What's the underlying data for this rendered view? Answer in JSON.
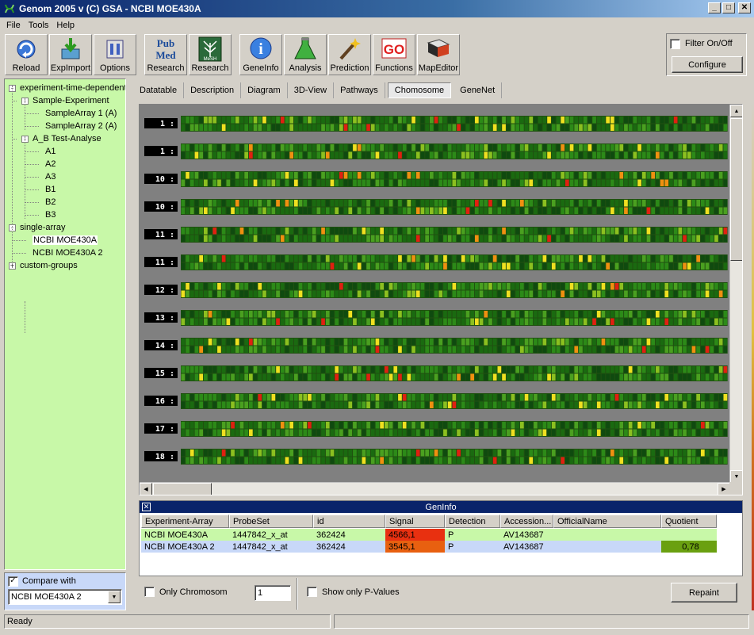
{
  "window": {
    "title": "Genom 2005 v (C) GSA - NCBI MOE430A"
  },
  "menu": [
    "File",
    "Tools",
    "Help"
  ],
  "toolbar": {
    "buttons": [
      {
        "label": "Reload",
        "icon": "reload-icon"
      },
      {
        "label": "ExpImport",
        "icon": "import-icon"
      },
      {
        "label": "Options",
        "icon": "options-icon"
      },
      {
        "label": "Research",
        "icon": "pubmed-icon",
        "badge": "Pub Med"
      },
      {
        "label": "Research",
        "icon": "mesh-icon",
        "badge": "MeSH"
      },
      {
        "label": "GeneInfo",
        "icon": "info-icon"
      },
      {
        "label": "Analysis",
        "icon": "flask-icon"
      },
      {
        "label": "Prediction",
        "icon": "wand-icon"
      },
      {
        "label": "Functions",
        "icon": "go-icon",
        "badge": "GO"
      },
      {
        "label": "MapEditor",
        "icon": "book-icon"
      }
    ],
    "filter_label": "Filter On/Off",
    "configure_label": "Configure"
  },
  "tree": {
    "nodes": [
      {
        "label": "experiment-time-dependent",
        "level": 0,
        "expander": "-"
      },
      {
        "label": "Sample-Experiment",
        "level": 1,
        "expander": "-"
      },
      {
        "label": "SampleArray 1 (A)",
        "level": 2
      },
      {
        "label": "SampleArray 2 (A)",
        "level": 2
      },
      {
        "label": "A_B Test-Analyse",
        "level": 1,
        "expander": "-"
      },
      {
        "label": "A1",
        "level": 2
      },
      {
        "label": "A2",
        "level": 2
      },
      {
        "label": "A3",
        "level": 2
      },
      {
        "label": "B1",
        "level": 2
      },
      {
        "label": "B2",
        "level": 2
      },
      {
        "label": "B3",
        "level": 2
      },
      {
        "label": "single-array",
        "level": 0,
        "expander": "-"
      },
      {
        "label": "NCBI MOE430A",
        "level": 1,
        "selected": true
      },
      {
        "label": "NCBI MOE430A 2",
        "level": 1
      },
      {
        "label": "custom-groups",
        "level": 0,
        "expander": "+"
      }
    ]
  },
  "compare": {
    "label": "Compare with",
    "checked": true,
    "value": "NCBI MOE430A 2"
  },
  "tabs": [
    "Datatable",
    "Description",
    "Diagram",
    "3D-View",
    "Pathways",
    "Chomosome",
    "GeneNet"
  ],
  "active_tab": "Chomosome",
  "chromosome_rows": [
    "1 :",
    "1 :",
    "10 :",
    "10 :",
    "11 :",
    "11 :",
    "12 :",
    "13 :",
    "14 :",
    "15 :",
    "16 :",
    "17 :",
    "18 :"
  ],
  "heatmap_colors": {
    "dark": "#0f4a0f",
    "green1": "#1a6a10",
    "green2": "#2c8a18",
    "green3": "#4aa020",
    "lime": "#8cc020",
    "yellow": "#f0e020",
    "orange": "#f09010",
    "red": "#e02010",
    "track_bg": "#205010"
  },
  "geninfo": {
    "title": "GenInfo",
    "columns": [
      "Experiment-Array",
      "ProbeSet",
      "id",
      "Signal",
      "Detection",
      "Accession...",
      "OfficialName",
      "Quotient"
    ],
    "rows": [
      {
        "experiment": "NCBI MOE430A",
        "probeset": "1447842_x_at",
        "id": "362424",
        "signal": "4566,1",
        "detection": "P",
        "accession": "AV143687",
        "official": "",
        "quotient": "",
        "bg": "#c8f8a8",
        "signal_bg": "#e83010"
      },
      {
        "experiment": "NCBI MOE430A 2",
        "probeset": "1447842_x_at",
        "id": "362424",
        "signal": "3545,1",
        "detection": "P",
        "accession": "AV143687",
        "official": "",
        "quotient": "0,78",
        "bg": "#c8d8f8",
        "signal_bg": "#e86010",
        "quotient_bg": "#6aa010"
      }
    ]
  },
  "bottom": {
    "only_chromosom_label": "Only Chromosom",
    "chromosom_value": "1",
    "pvalues_label": "Show only P-Values",
    "repaint_label": "Repaint"
  },
  "status": {
    "text": "Ready"
  }
}
